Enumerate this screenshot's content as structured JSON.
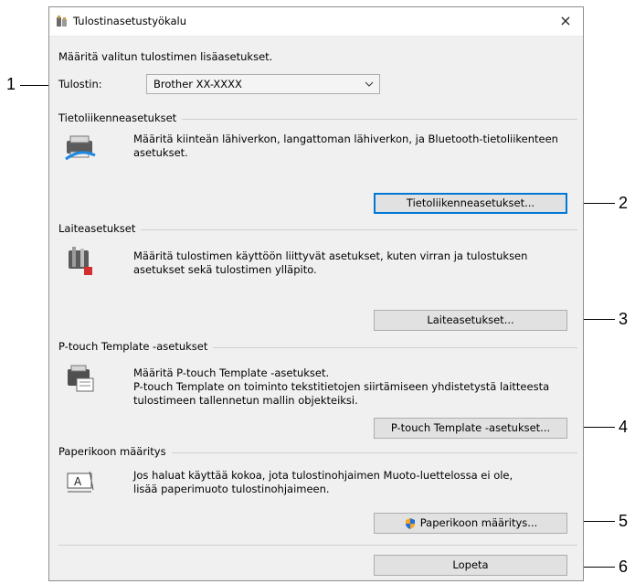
{
  "window": {
    "title": "Tulostinasetustyökalu",
    "close_glyph": "×"
  },
  "intro": "Määritä valitun tulostimen lisäasetukset.",
  "printer": {
    "label": "Tulostin:",
    "value": "Brother  XX-XXXX"
  },
  "sections": {
    "network": {
      "title": "Tietoliikenneasetukset",
      "desc": [
        "Määritä kiinteän lähiverkon, langattoman lähiverkon, ja Bluetooth-tietoliikenteen",
        "asetukset."
      ],
      "button": "Tietoliikenneasetukset...",
      "icon": "network-printer-icon"
    },
    "device": {
      "title": "Laiteasetukset",
      "desc": [
        "Määritä tulostimen käyttöön liittyvät asetukset, kuten virran ja tulostuksen",
        "asetukset sekä tulostimen ylläpito."
      ],
      "button": "Laiteasetukset...",
      "icon": "device-tools-icon"
    },
    "template": {
      "title": "P-touch Template -asetukset",
      "desc": [
        "Määritä P-touch Template -asetukset.",
        "P-touch Template on toiminto tekstitietojen siirtämiseen yhdistetystä laitteesta",
        "tulostimeen tallennetun mallin objekteiksi."
      ],
      "button": "P-touch Template -asetukset...",
      "icon": "template-printer-icon"
    },
    "paper": {
      "title": "Paperikoon määritys",
      "desc": [
        "Jos haluat käyttää kokoa, jota tulostinohjaimen Muoto-luettelossa ei ole,",
        "lisää paperimuoto tulostinohjaimeen."
      ],
      "button": "Paperikoon määritys...",
      "icon": "paper-size-icon"
    }
  },
  "exit_button": "Lopeta",
  "callouts": [
    "1",
    "2",
    "3",
    "4",
    "5",
    "6"
  ]
}
